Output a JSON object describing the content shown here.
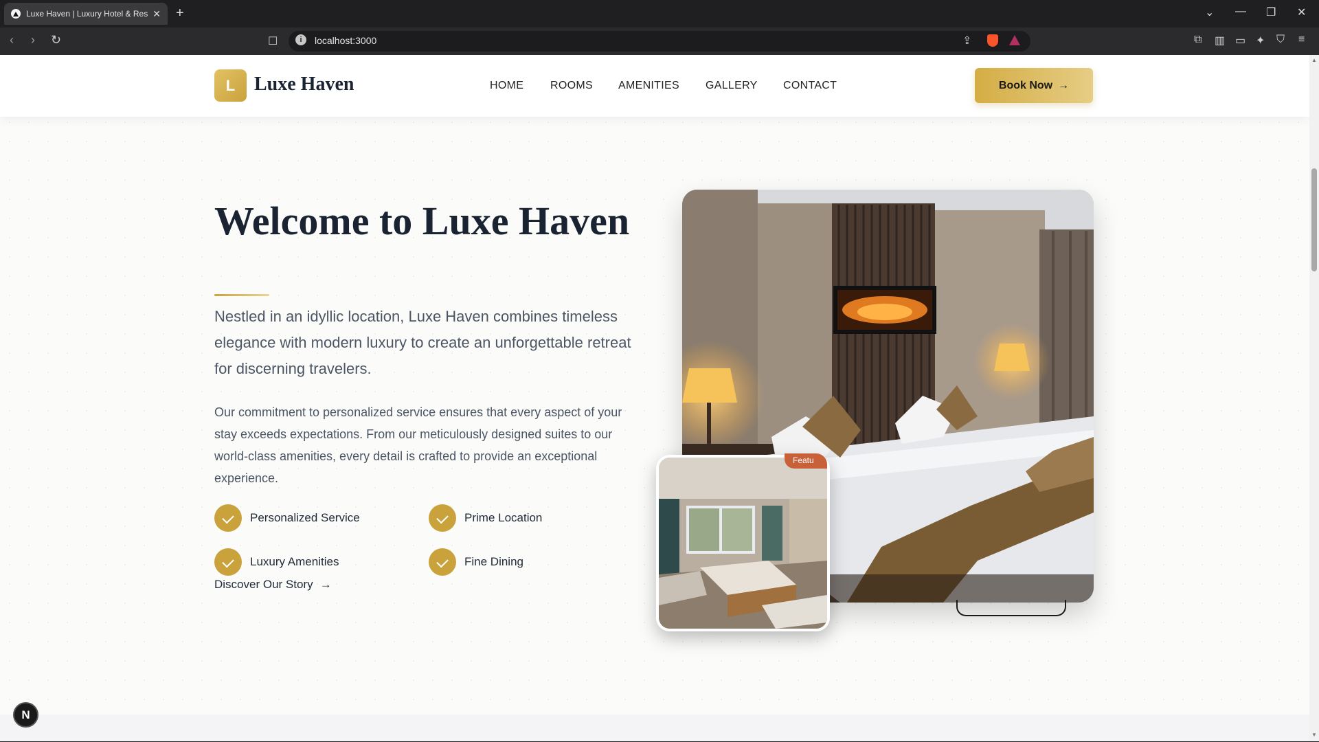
{
  "browser": {
    "tab_title": "Luxe Haven | Luxury Hotel & Res",
    "tab_close": "✕",
    "new_tab": "+",
    "url": "localhost:3000",
    "icons": [
      "back-icon",
      "forward-icon",
      "reload-icon",
      "bookmark-icon",
      "info-icon",
      "share-icon",
      "brave-shield-icon",
      "brave-rewards-icon",
      "extensions-icon",
      "sidebar-icon",
      "wallet-icon",
      "leo-ai-icon",
      "vpn-icon",
      "menu-icon"
    ],
    "window_controls": [
      "⌄",
      "—",
      "❐",
      "✕"
    ]
  },
  "header": {
    "logo_letter": "L",
    "logo_text": "Luxe Haven",
    "nav": [
      "HOME",
      "ROOMS",
      "AMENITIES",
      "GALLERY",
      "CONTACT"
    ],
    "cta_label": "Book Now",
    "cta_arrow": "→"
  },
  "hero": {
    "title": "Welcome to Luxe Haven",
    "lead": "Nestled in an idyllic location, Luxe Haven combines timeless elegance with modern luxury to create an unforgettable retreat for discerning travelers.",
    "body": "Our commitment to personalized service ensures that every aspect of your stay exceeds expectations. From our meticulously designed suites to our world-class amenities, every detail is crafted to provide an exceptional experience.",
    "features": [
      "Personalized Service",
      "Prime Location",
      "Luxury Amenities",
      "Fine Dining"
    ],
    "discover_label": "Discover Our Story",
    "discover_arrow": "→",
    "featured_tag": "Featu"
  },
  "dev_badge": "N",
  "colors": {
    "gold": "#c9a23c",
    "navy": "#1a2332",
    "text_gray": "#4b5563",
    "tag_orange": "#c8603a"
  }
}
